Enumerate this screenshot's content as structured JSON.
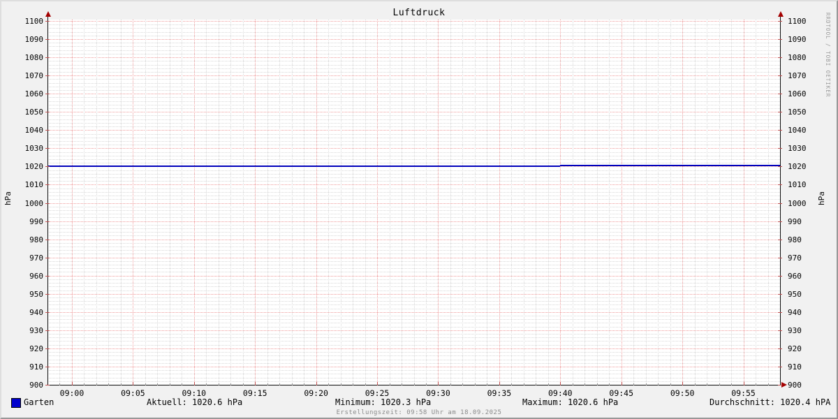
{
  "title": "Luftdruck",
  "watermark": "RRDTOOL / TOBI OETIKER",
  "footer": "Erstellungszeit: 09:58 Uhr am 18.09.2025",
  "y_axis_label_left": "hPa",
  "y_axis_label_right": "hPa",
  "legend": {
    "series_label": "Garten",
    "series_color": "#0000cc",
    "current": "Aktuell: 1020.6 hPa",
    "minimum": "Minimum: 1020.3 hPa",
    "maximum": "Maximum: 1020.6 hPa",
    "average": "Durchschnitt: 1020.4 hPA"
  },
  "colors": {
    "background": "#f1f1f1",
    "canvas": "#ffffff",
    "grid_major": "#ef9a9a",
    "grid_minor": "#d8d8d8",
    "axis": "#0d0d0d",
    "arrow": "#a40000",
    "tick_major": "#c05050",
    "tick_minor": "#9a9a9a",
    "line": "#0000bb",
    "watermark": "#9a9a9a",
    "footer_text": "#8a8a8a"
  },
  "chart_data": {
    "type": "line",
    "title": "Luftdruck",
    "ylabel": "hPa",
    "ylim": [
      900,
      1100
    ],
    "y_major_step": 10,
    "y_minor_step": 2,
    "y_tick_labels": [
      "900",
      "910",
      "920",
      "930",
      "940",
      "950",
      "960",
      "970",
      "980",
      "990",
      "1000",
      "1010",
      "1020",
      "1030",
      "1040",
      "1050",
      "1060",
      "1070",
      "1080",
      "1090",
      "1100"
    ],
    "xlim_minutes": [
      -2,
      58
    ],
    "x_major_step_minutes": 5,
    "x_minor_step_minutes": 1,
    "x_major_ticks": [
      {
        "minute": 0,
        "label": "09:00"
      },
      {
        "minute": 5,
        "label": "09:05"
      },
      {
        "minute": 10,
        "label": "09:10"
      },
      {
        "minute": 15,
        "label": "09:15"
      },
      {
        "minute": 20,
        "label": "09:20"
      },
      {
        "minute": 25,
        "label": "09:25"
      },
      {
        "minute": 30,
        "label": "09:30"
      },
      {
        "minute": 35,
        "label": "09:35"
      },
      {
        "minute": 40,
        "label": "09:40"
      },
      {
        "minute": 45,
        "label": "09:45"
      },
      {
        "minute": 50,
        "label": "09:50"
      },
      {
        "minute": 55,
        "label": "09:55"
      }
    ],
    "grid": true,
    "legend_position": "bottom",
    "series": [
      {
        "name": "Garten",
        "color": "#0000bb",
        "points_minute_hpa": [
          [
            -2,
            1020.3
          ],
          [
            40,
            1020.3
          ],
          [
            40,
            1020.6
          ],
          [
            58,
            1020.6
          ]
        ],
        "stats": {
          "current": 1020.6,
          "min": 1020.3,
          "max": 1020.6,
          "avg": 1020.4
        }
      }
    ]
  }
}
